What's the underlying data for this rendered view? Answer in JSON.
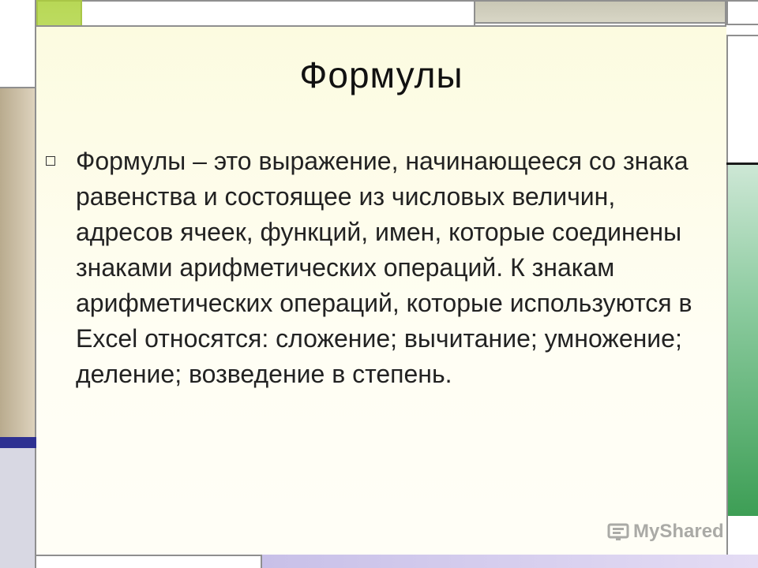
{
  "slide": {
    "title": "Формулы",
    "bullets": [
      {
        "icon": "square-bullet-icon",
        "text": "Формулы – это выражение, начинающееся со знака равенства и состоящее из числовых величин, адресов ячеек, функций, имен, которые соединены знаками арифметических операций. К знакам арифметических операций, которые используются в Excel относятся: сложение; вычитание; умножение; деление; возведение в степень."
      }
    ]
  },
  "watermark": {
    "text": "MyShared",
    "icon": "myshared-logo-icon"
  },
  "colors": {
    "panel_background": "#fcfbe0",
    "accent_green": "#b8d856",
    "accent_blue": "#2e3192",
    "right_green": "#3d9e55",
    "border_gray": "#8f8f8f"
  }
}
